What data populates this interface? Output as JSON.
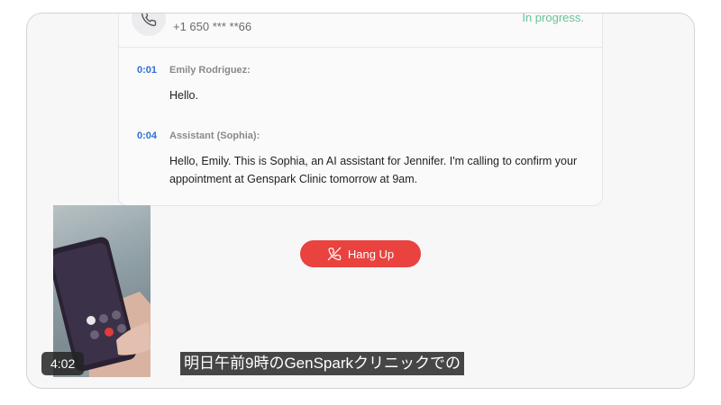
{
  "call": {
    "phone_number": "+1 650 *** **66",
    "status": "In progress."
  },
  "transcript": [
    {
      "time": "0:01",
      "speaker": "Emily Rodriguez:",
      "text": "Hello."
    },
    {
      "time": "0:04",
      "speaker": "Assistant (Sophia):",
      "text": "Hello, Emily. This is Sophia, an AI assistant for Jennifer. I'm calling to confirm your appointment at Genspark Clinic tomorrow at 9am."
    }
  ],
  "hangup_label": "Hang Up",
  "video": {
    "duration": "4:02",
    "subtitle": "明日午前9時のGenSparkクリニックでの"
  },
  "colors": {
    "hangup": "#e9423f",
    "status": "#66c29a",
    "timestamp": "#2f6fd6"
  }
}
